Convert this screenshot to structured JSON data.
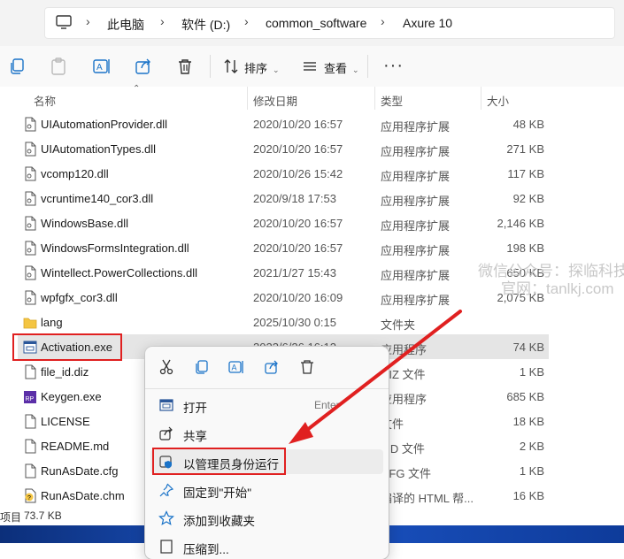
{
  "address": {
    "breadcrumbs": [
      "此电脑",
      "软件 (D:)",
      "common_software",
      "Axure 10"
    ]
  },
  "toolbar": {
    "sort_label": "排序",
    "view_label": "查看",
    "more_label": "···"
  },
  "columns": {
    "name": "名称",
    "date": "修改日期",
    "type": "类型",
    "size": "大小"
  },
  "files": [
    {
      "name": "UIAutomationProvider.dll",
      "date": "2020/10/20 16:57",
      "type": "应用程序扩展",
      "size": "48 KB",
      "icon": "file-icon"
    },
    {
      "name": "UIAutomationTypes.dll",
      "date": "2020/10/20 16:57",
      "type": "应用程序扩展",
      "size": "271 KB",
      "icon": "file-icon"
    },
    {
      "name": "vcomp120.dll",
      "date": "2020/10/26 15:42",
      "type": "应用程序扩展",
      "size": "117 KB",
      "icon": "file-icon"
    },
    {
      "name": "vcruntime140_cor3.dll",
      "date": "2020/9/18 17:53",
      "type": "应用程序扩展",
      "size": "92 KB",
      "icon": "file-icon"
    },
    {
      "name": "WindowsBase.dll",
      "date": "2020/10/20 16:57",
      "type": "应用程序扩展",
      "size": "2,146 KB",
      "icon": "file-icon"
    },
    {
      "name": "WindowsFormsIntegration.dll",
      "date": "2020/10/20 16:57",
      "type": "应用程序扩展",
      "size": "198 KB",
      "icon": "file-icon"
    },
    {
      "name": "Wintellect.PowerCollections.dll",
      "date": "2021/1/27 15:43",
      "type": "应用程序扩展",
      "size": "650 KB",
      "icon": "file-icon"
    },
    {
      "name": "wpfgfx_cor3.dll",
      "date": "2020/10/20 16:09",
      "type": "应用程序扩展",
      "size": "2,075 KB",
      "icon": "file-icon"
    },
    {
      "name": "lang",
      "date": "2025/10/30 0:15",
      "type": "文件夹",
      "size": "",
      "icon": "folder-icon"
    },
    {
      "name": "Activation.exe",
      "date": "2023/6/26 16:12",
      "type": "应用程序",
      "size": "74 KB",
      "icon": "app-window-icon"
    },
    {
      "name": "file_id.diz",
      "date": "",
      "type": "DIZ 文件",
      "size": "1 KB",
      "icon": "file-icon"
    },
    {
      "name": "Keygen.exe",
      "date": "",
      "type": "应用程序",
      "size": "685 KB",
      "icon": "keygen-app-icon"
    },
    {
      "name": "LICENSE",
      "date": "",
      "type": "文件",
      "size": "18 KB",
      "icon": "file-icon"
    },
    {
      "name": "README.md",
      "date": "",
      "type": "MD 文件",
      "size": "2 KB",
      "icon": "file-icon"
    },
    {
      "name": "RunAsDate.cfg",
      "date": "",
      "type": "CFG 文件",
      "size": "1 KB",
      "icon": "file-icon"
    },
    {
      "name": "RunAsDate.chm",
      "date": "",
      "type": "编译的 HTML 帮...",
      "size": "16 KB",
      "icon": "help-file-icon"
    }
  ],
  "status": {
    "items_label": "项目",
    "selected_size": "73.7 KB"
  },
  "watermark": {
    "line1": "微信公众号：探临科技",
    "line2": "官网：tanlkj.com"
  },
  "context_menu": {
    "items": [
      {
        "label": "打开",
        "shortcut": "Enter",
        "icon": "open-icon"
      },
      {
        "label": "共享",
        "shortcut": "",
        "icon": "share-icon"
      },
      {
        "label": "以管理员身份运行",
        "shortcut": "",
        "icon": "shield-icon"
      },
      {
        "label": "固定到\"开始\"",
        "shortcut": "",
        "icon": "pin-icon"
      },
      {
        "label": "添加到收藏夹",
        "shortcut": "",
        "icon": "star-icon"
      },
      {
        "label": "压缩到...",
        "shortcut": "",
        "icon": "zip-icon"
      }
    ]
  },
  "colors": {
    "highlight_red": "#e02020",
    "selected_row": "#e5e5e5",
    "accent_blue": "#1a73c8"
  }
}
